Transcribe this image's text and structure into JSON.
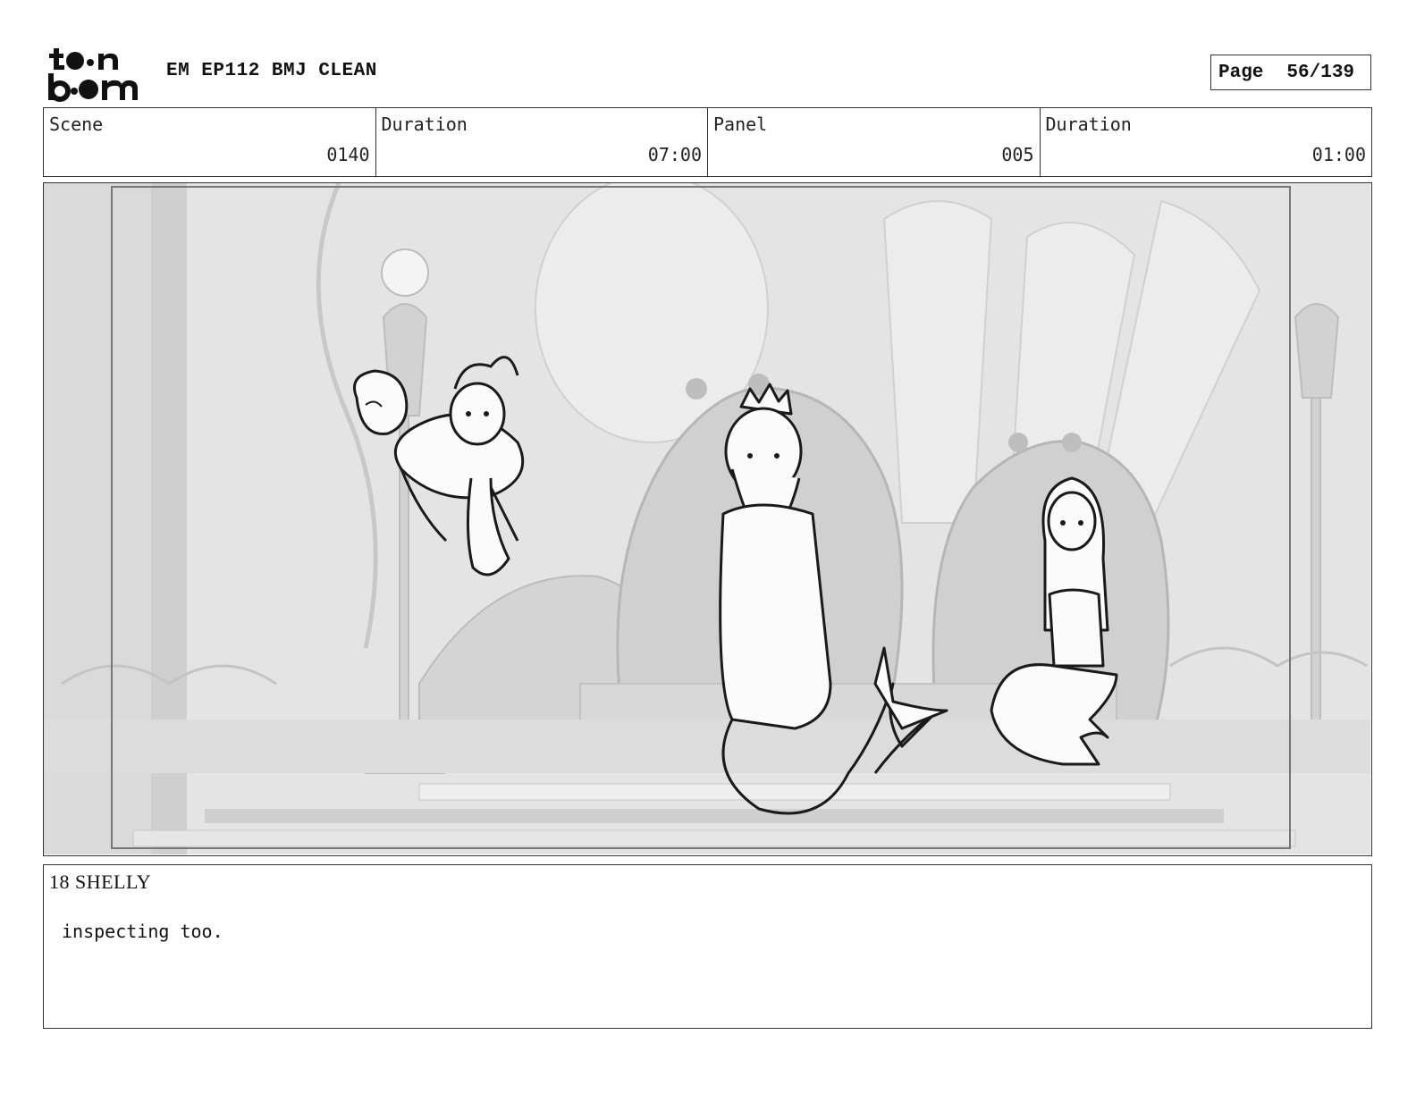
{
  "header": {
    "logo_top": "toon",
    "logo_bottom": "boom",
    "title": "EM EP112 BMJ CLEAN",
    "page_label": "Page",
    "page_value": "56/139"
  },
  "info": {
    "scene_label": "Scene",
    "scene_value": "0140",
    "duration1_label": "Duration",
    "duration1_value": "07:00",
    "panel_label": "Panel",
    "panel_value": "005",
    "duration2_label": "Duration",
    "duration2_value": "01:00"
  },
  "notes": {
    "header": "18 SHELLY",
    "text": "inspecting too."
  },
  "colors": {
    "border": "#333333",
    "background_art": "#d9d9d9"
  }
}
